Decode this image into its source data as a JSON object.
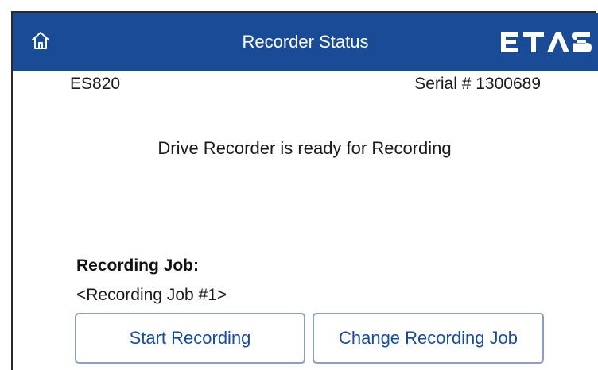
{
  "header": {
    "title": "Recorder Status",
    "home_icon": "home-icon",
    "logo_text": "ETAS",
    "background_color": "#1a4b97"
  },
  "device": {
    "model": "ES820",
    "serial": "Serial # 1300689"
  },
  "status": {
    "message": "Drive Recorder is ready for Recording"
  },
  "job": {
    "label": "Recording Job:",
    "name": "<Recording Job #1>"
  },
  "actions": {
    "start_label": "Start Recording",
    "change_label": "Change Recording Job",
    "button_text_color": "#1a4b97",
    "button_border_color": "#8d9fc0"
  }
}
